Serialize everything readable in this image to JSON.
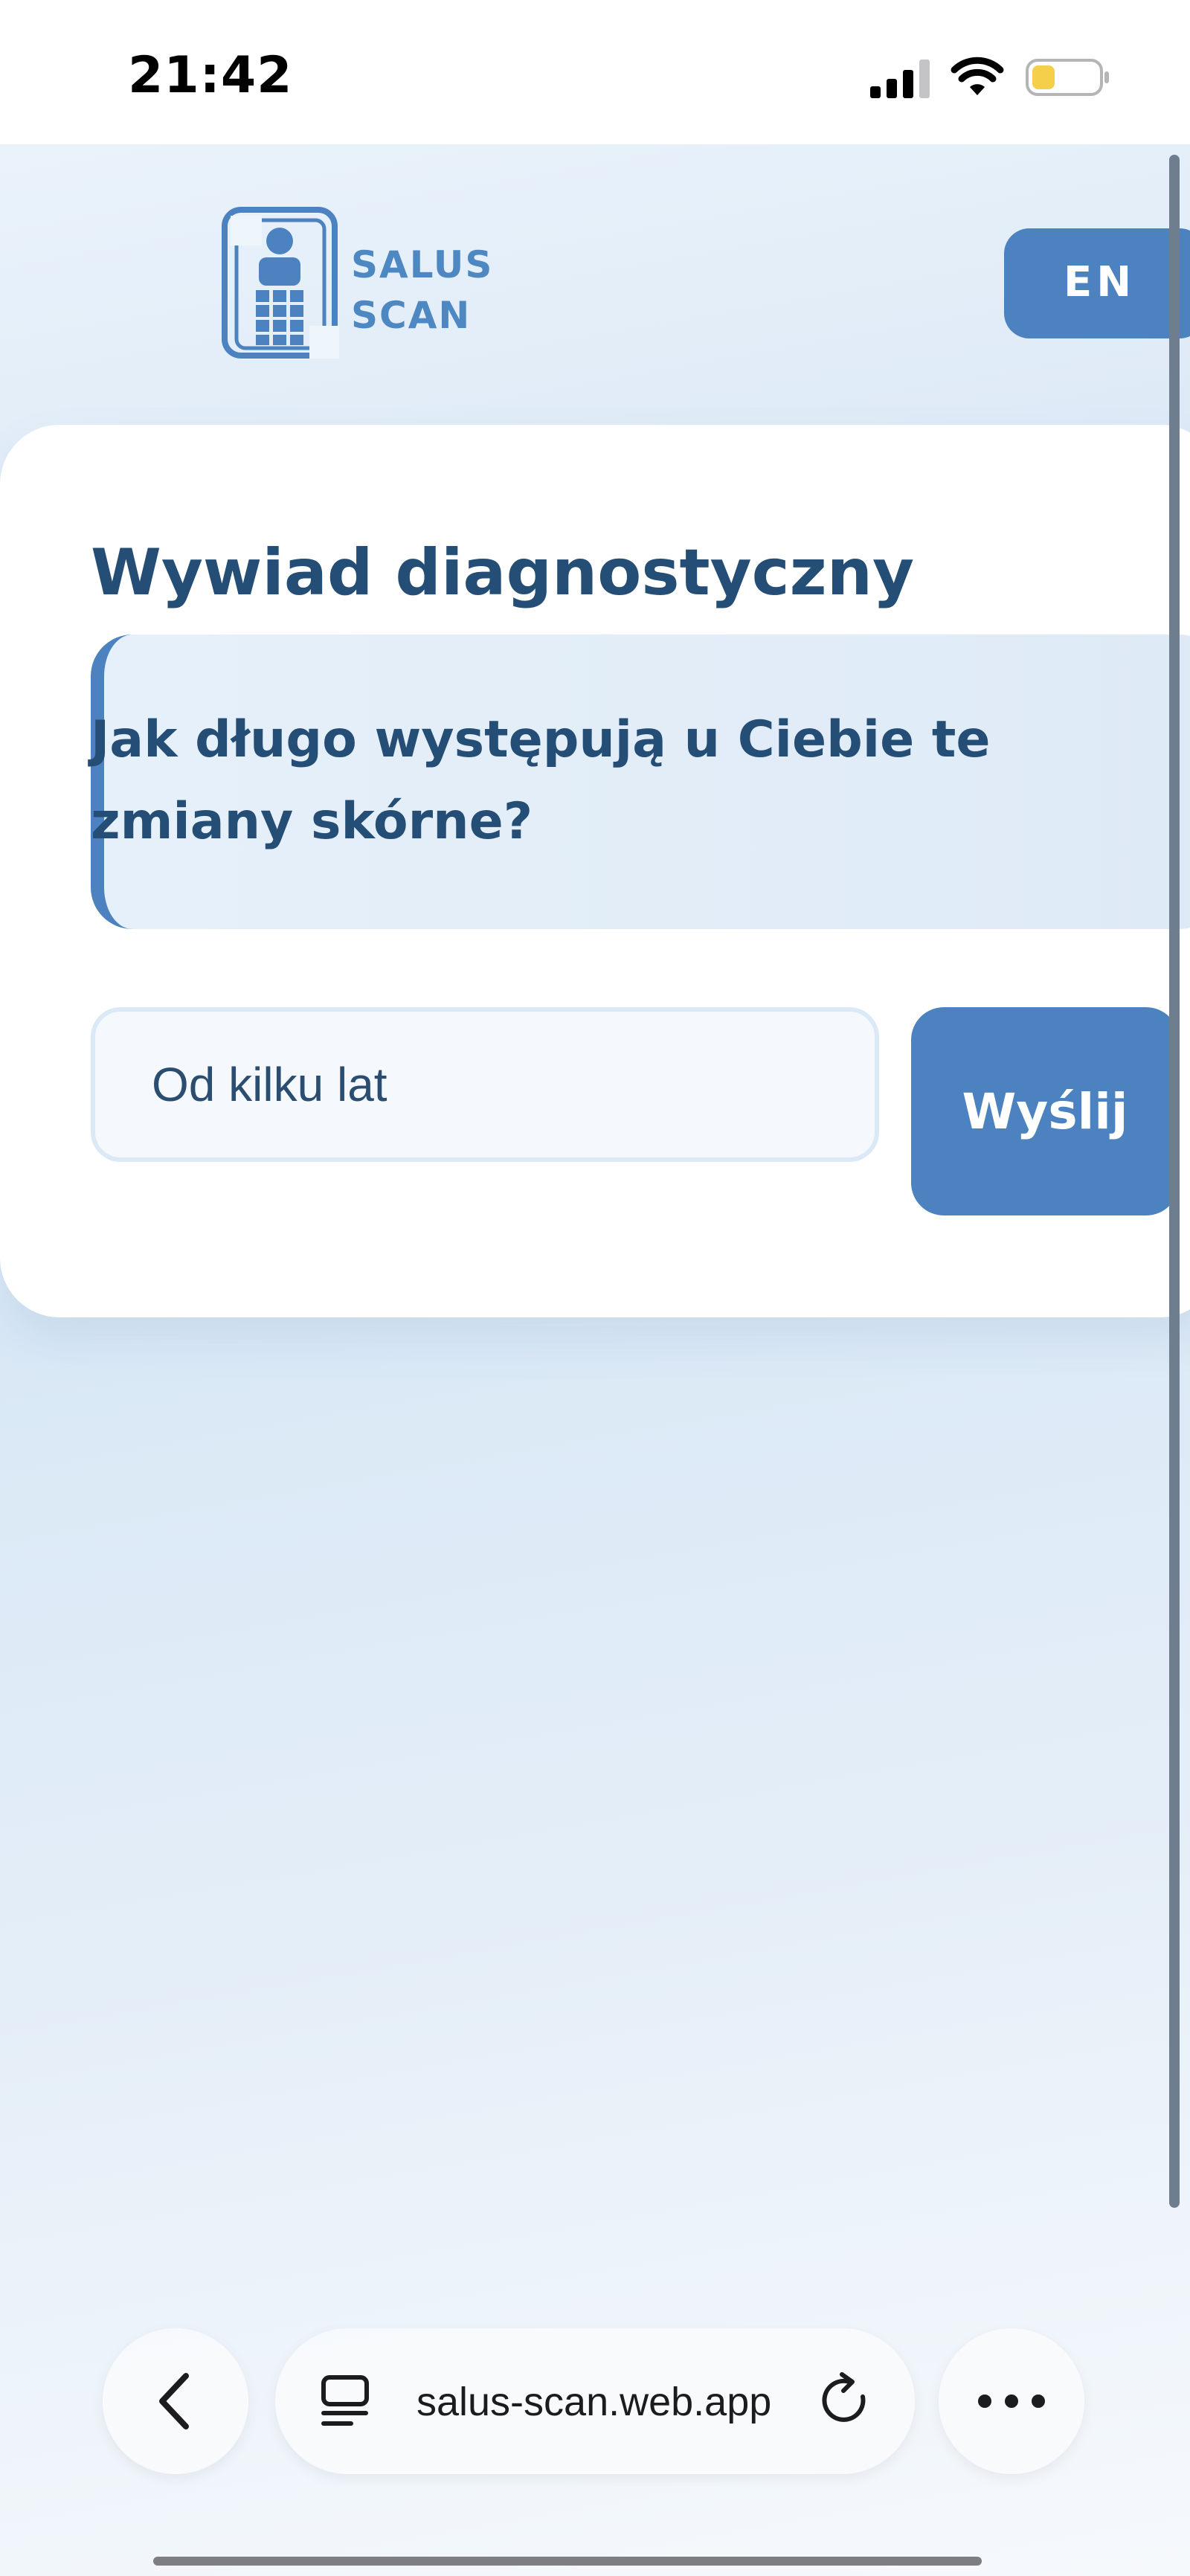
{
  "status_bar": {
    "time": "21:42",
    "icons": [
      "cellular-signal-icon",
      "wifi-icon",
      "battery-icon"
    ],
    "battery_color": "#f5cf4a"
  },
  "header": {
    "logo_icon": "phone-person-logo-icon",
    "brand_line1": "SALUS",
    "brand_line2": "SCAN",
    "language_button": "EN"
  },
  "card": {
    "title": "Wywiad diagnostyczny",
    "question": "Jak długo występują u Ciebie te zmiany skórne?",
    "answer_value": "Od kilku lat",
    "send_label": "Wyślij"
  },
  "browser": {
    "url": "salus-scan.web.app",
    "icons": [
      "back-chevron-icon",
      "tabs-icon",
      "reload-icon",
      "more-dots-icon"
    ]
  },
  "colors": {
    "accent": "#4b82bf",
    "title": "#244e75",
    "brand_text": "#4d88c2"
  }
}
